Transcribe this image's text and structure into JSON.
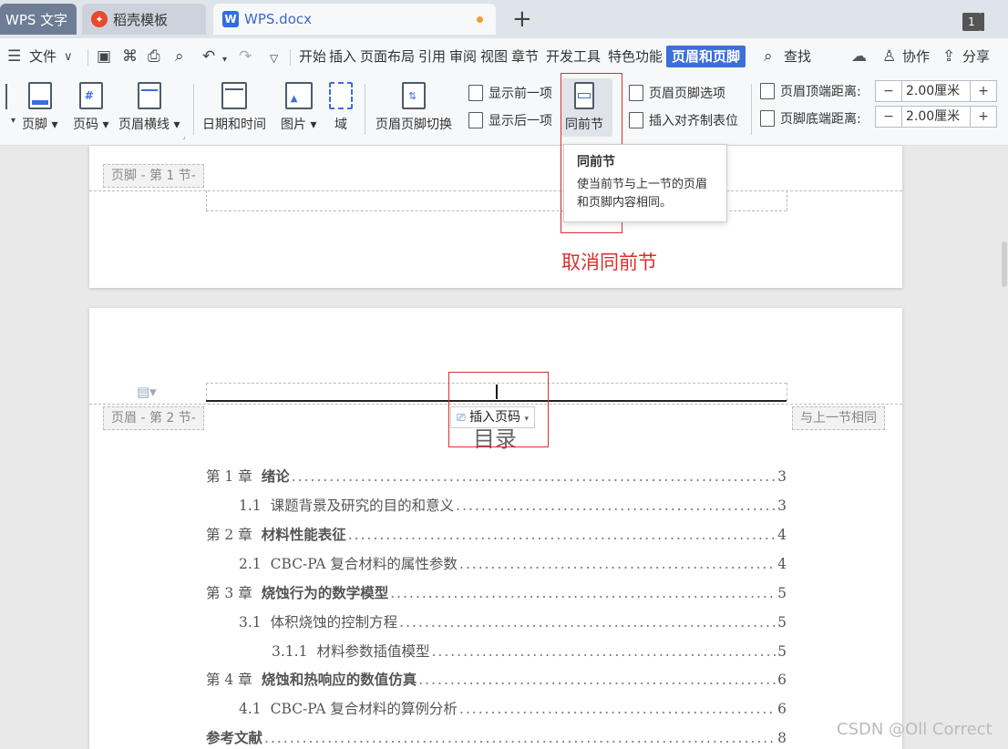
{
  "tabs": [
    {
      "label": "WPS 文字"
    },
    {
      "label": "稻壳模板",
      "icon": "daoke-logo-icon"
    },
    {
      "label": "WPS.docx",
      "icon": "wps-writer-icon",
      "modified": true
    }
  ],
  "window_count": "1",
  "menu": {
    "file": "文件",
    "items": [
      "开始",
      "插入",
      "页面布局",
      "引用",
      "审阅",
      "视图",
      "章节",
      "开发工具",
      "特色功能",
      "页眉和页脚"
    ],
    "active": "页眉和页脚",
    "search": "查找",
    "collab": "协作",
    "share": "分享"
  },
  "ribbon": {
    "footer": "页脚",
    "page_number": "页码",
    "header_line": "页眉横线",
    "datetime": "日期和时间",
    "picture": "图片",
    "field": "域",
    "switch": "页眉页脚切换",
    "show_prev": "显示前一项",
    "show_next": "显示后一项",
    "same_as_prev": "同前节",
    "options": "页眉页脚选项",
    "insert_align_tab": "插入对齐制表位",
    "header_top_label": "页眉顶端距离:",
    "header_top_value": "2.00厘米",
    "footer_bottom_label": "页脚底端距离:",
    "footer_bottom_value": "2.00厘米"
  },
  "tooltip": {
    "title": "同前节",
    "body": "使当前节与上一节的页眉和页脚内容相同。"
  },
  "annotation": "取消同前节",
  "doc": {
    "footer_tag": "页脚  - 第 1 节-",
    "header_tag": "页眉  - 第 2 节-",
    "same_as_prev_tag": "与上一节相同",
    "insert_page_number": "插入页码",
    "toc_title": "目录",
    "toc": [
      {
        "num": "第 1 章",
        "title": "绪论",
        "page": "3",
        "level": 1
      },
      {
        "num": "1.1",
        "title": "课题背景及研究的目的和意义",
        "page": "3",
        "level": 2
      },
      {
        "num": "第 2 章",
        "title": "材料性能表征",
        "page": "4",
        "level": 1
      },
      {
        "num": "2.1",
        "title": "CBC-PA 复合材料的属性参数",
        "page": "4",
        "level": 2
      },
      {
        "num": "第 3 章",
        "title": "烧蚀行为的数学模型",
        "page": "5",
        "level": 1
      },
      {
        "num": "3.1",
        "title": "体积烧蚀的控制方程",
        "page": "5",
        "level": 2
      },
      {
        "num": "3.1.1",
        "title": "材料参数插值模型",
        "page": "5",
        "level": 3
      },
      {
        "num": "第 4 章",
        "title": "烧蚀和热响应的数值仿真",
        "page": "6",
        "level": 1
      },
      {
        "num": "4.1",
        "title": "CBC-PA 复合材料的算例分析",
        "page": "6",
        "level": 2
      },
      {
        "num": "",
        "title": "参考文献",
        "page": "8",
        "level": 1
      }
    ]
  },
  "watermark": "CSDN @Oll Correct",
  "colors": {
    "accent": "#3b6fd9",
    "annotation_red": "#d9302c"
  }
}
